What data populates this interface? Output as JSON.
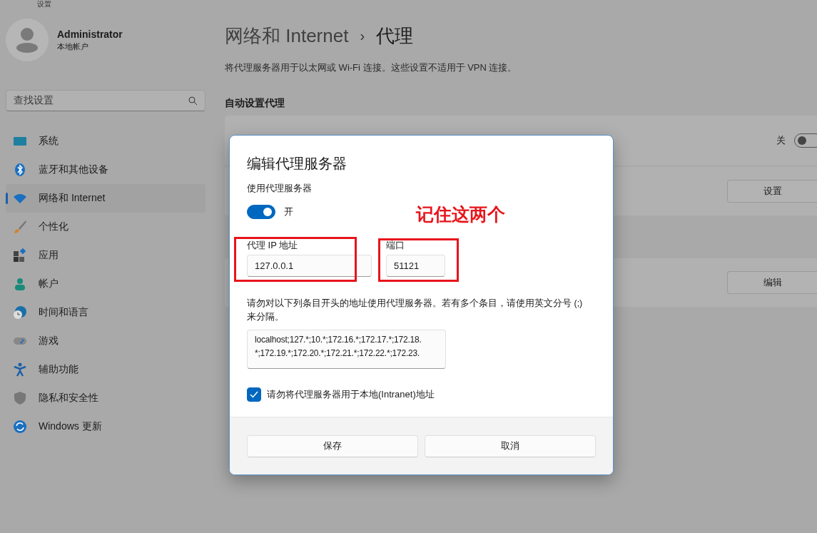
{
  "window": {
    "title": "设置"
  },
  "account": {
    "name": "Administrator",
    "type": "本地帐户"
  },
  "search": {
    "placeholder": "查找设置"
  },
  "sidebar": {
    "items": [
      {
        "label": "系统",
        "selected": false
      },
      {
        "label": "蓝牙和其他设备",
        "selected": false
      },
      {
        "label": "网络和 Internet",
        "selected": true
      },
      {
        "label": "个性化",
        "selected": false
      },
      {
        "label": "应用",
        "selected": false
      },
      {
        "label": "帐户",
        "selected": false
      },
      {
        "label": "时间和语言",
        "selected": false
      },
      {
        "label": "游戏",
        "selected": false
      },
      {
        "label": "辅助功能",
        "selected": false
      },
      {
        "label": "隐私和安全性",
        "selected": false
      },
      {
        "label": "Windows 更新",
        "selected": false
      }
    ]
  },
  "breadcrumb": {
    "parent": "网络和 Internet",
    "separator": "›",
    "current": "代理"
  },
  "description": "将代理服务器用于以太网或 Wi-Fi 连接。这些设置不适用于 VPN 连接。",
  "section": {
    "title": "自动设置代理"
  },
  "rows": [
    {
      "kind": "toggle",
      "state_label": "关",
      "on": false
    },
    {
      "kind": "button",
      "button": "设置"
    },
    {
      "kind": "blank"
    },
    {
      "kind": "button",
      "button": "编辑"
    }
  ],
  "dialog": {
    "title": "编辑代理服务器",
    "use_proxy": {
      "label": "使用代理服务器",
      "on": true,
      "state_label": "开"
    },
    "ip": {
      "label": "代理 IP 地址",
      "value": "127.0.0.1"
    },
    "port": {
      "label": "端口",
      "value": "51121"
    },
    "exceptions_hint": "请勿对以下列条目开头的地址使用代理服务器。若有多个条目，请使用英文分号 (;) 来分隔。",
    "exceptions": {
      "value_lines": [
        "localhost;127.*;10.*;172.16.*;172.17.*;172.18.",
        "*;172.19.*;172.20.*;172.21.*;172.22.*;172.23."
      ]
    },
    "bypass_local": {
      "label": "请勿将代理服务器用于本地(Intranet)地址",
      "checked": true
    },
    "buttons": [
      "保存",
      "取消"
    ]
  },
  "annotation": {
    "text": "记住这两个"
  }
}
